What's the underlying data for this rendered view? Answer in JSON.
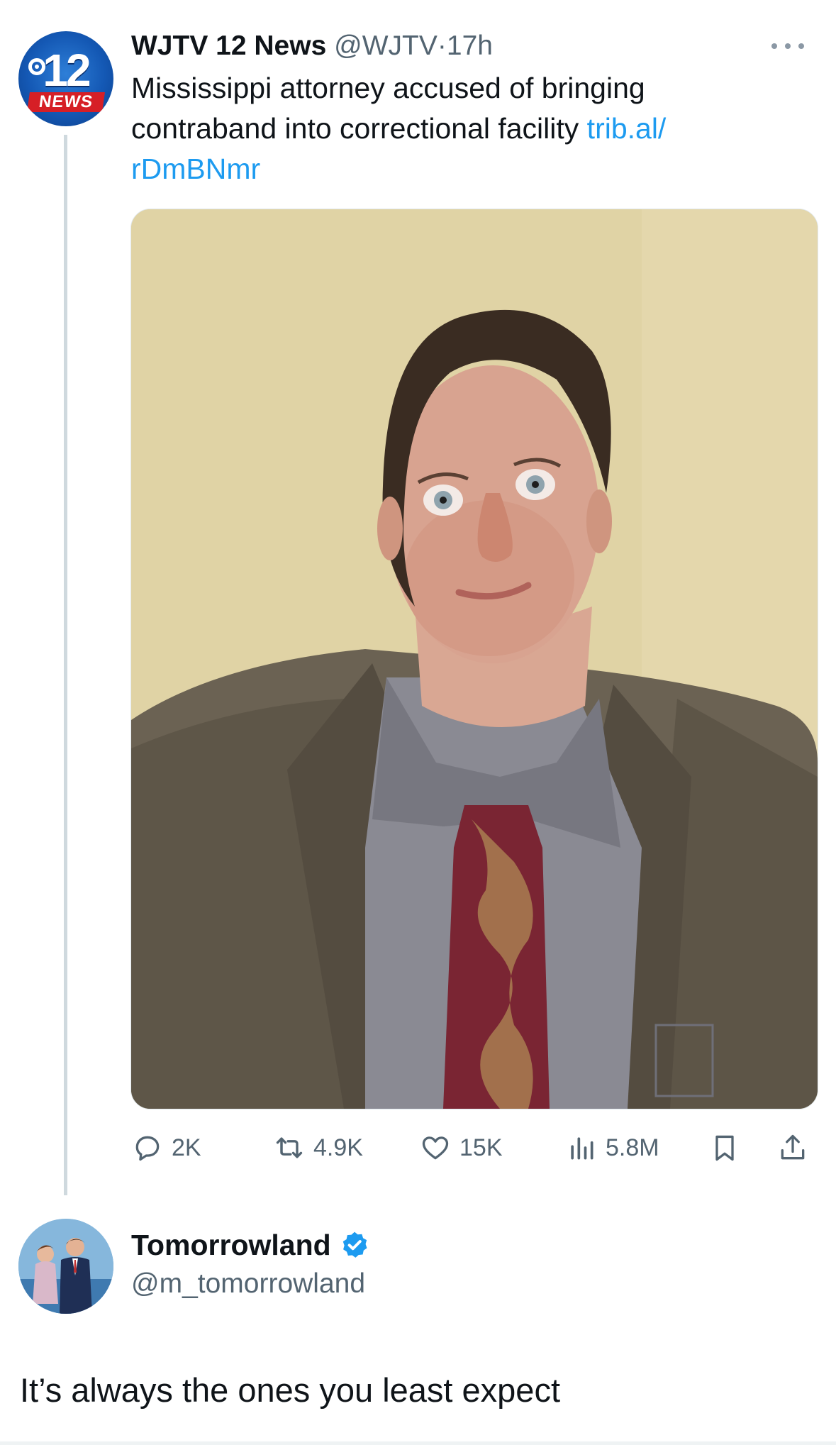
{
  "tweet": {
    "author_name": "WJTV 12 News",
    "author_handle": "@WJTV",
    "separator": "·",
    "time": "17h",
    "avatar": {
      "number": "12",
      "label": "NEWS",
      "colors": {
        "blue": "#1458b4",
        "red": "#d61f26"
      }
    },
    "text": "Mississippi attorney accused of bringing contraband into correctional facility ",
    "link": "trib.al/\nrDmBNmr",
    "more_icon": "more-horizontal-icon",
    "photo_description_icon": "photo"
  },
  "actions": {
    "reply_count": "2K",
    "retweet_count": "4.9K",
    "like_count": "15K",
    "views_count": "5.8M",
    "icons": [
      "reply-icon",
      "retweet-icon",
      "like-icon",
      "views-icon",
      "bookmark-icon",
      "share-icon"
    ]
  },
  "reply": {
    "author_name": "Tomorrowland",
    "author_handle": "@m_tomorrowland",
    "verified": true,
    "text": "It’s always the ones you least expect"
  },
  "colors": {
    "text": "#0f1419",
    "secondary": "#536471",
    "link": "#1d9bf0",
    "thread_line": "#cfd9de"
  }
}
